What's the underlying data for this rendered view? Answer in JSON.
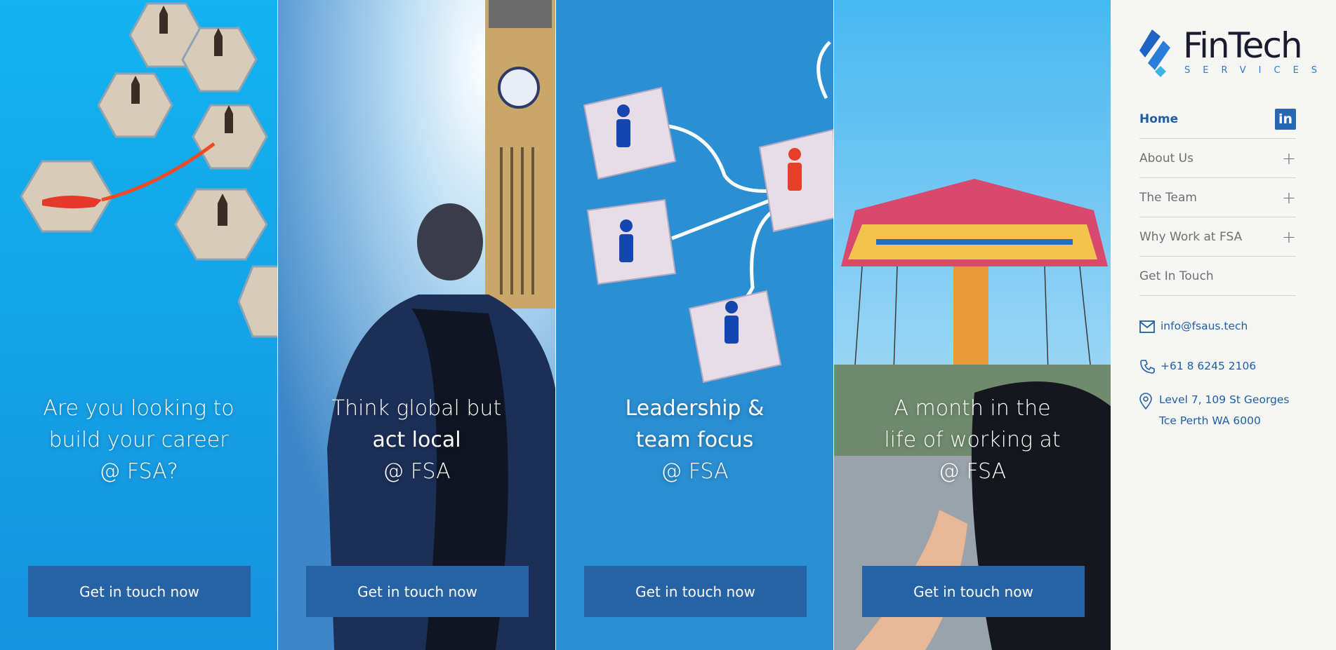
{
  "panels": [
    {
      "lines": [
        "Are you looking to",
        "build your career",
        "@ FSA?"
      ],
      "cta": "Get in touch now",
      "theme": "rockets"
    },
    {
      "lines": [
        "Think global but",
        "act local",
        "@ FSA"
      ],
      "cta": "Get in touch now",
      "theme": "big-ben"
    },
    {
      "lines": [
        "Leadership &",
        "team focus",
        "@ FSA"
      ],
      "cta": "Get in touch now",
      "theme": "org-blocks"
    },
    {
      "lines": [
        "A month in the",
        "life of working at",
        "@ FSA"
      ],
      "cta": "Get in touch now",
      "theme": "carousel"
    }
  ],
  "logo": {
    "word": "FinTech",
    "sub": "SERVICES"
  },
  "nav": [
    {
      "label": "Home",
      "active": true
    },
    {
      "label": "About Us",
      "expandable": true
    },
    {
      "label": "The Team",
      "expandable": true
    },
    {
      "label": "Why Work at FSA",
      "expandable": true
    },
    {
      "label": "Get In Touch"
    }
  ],
  "social": {
    "icon": "linkedin-icon",
    "label": "in"
  },
  "contact": {
    "email": "info@fsaus.tech",
    "phone": "+61 8 6245 2106",
    "address_line1": "Level 7, 109 St Georges",
    "address_line2": "Tce Perth WA 6000"
  },
  "colors": {
    "brand": "#2563a6",
    "accent": "#1f5fa6",
    "sky": "#0ea5e9"
  }
}
